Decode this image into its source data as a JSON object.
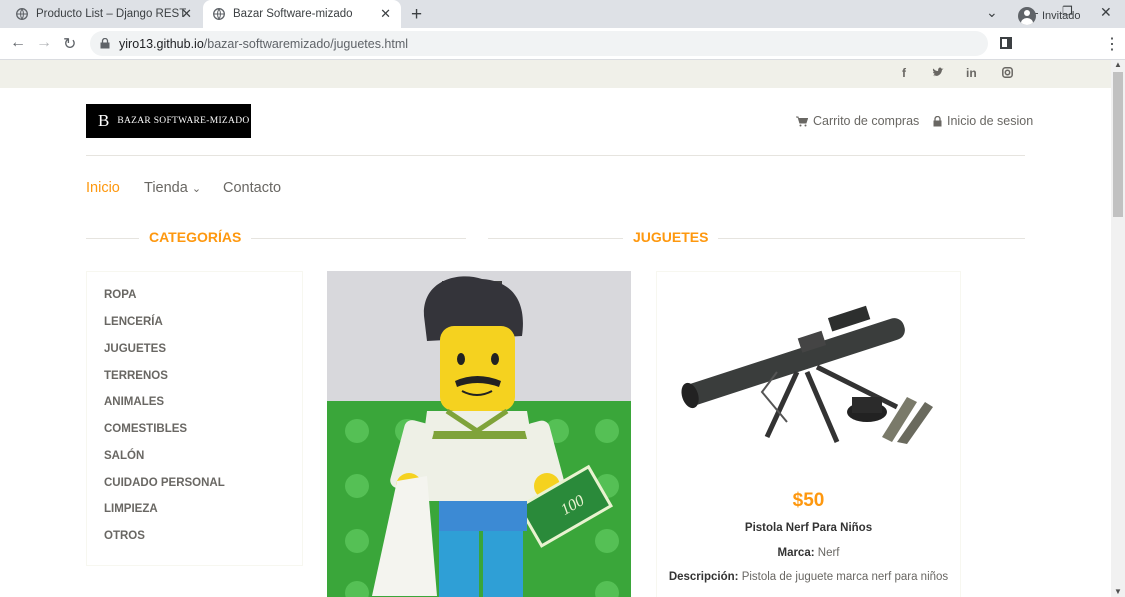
{
  "browser": {
    "tabs": [
      {
        "title": "Producto List – Django REST fram"
      },
      {
        "title": "Bazar Software-mizado"
      }
    ],
    "url_host": "yiro13.github.io",
    "url_path": "/bazar-softwaremizado/juguetes.html",
    "profile": "Invitado"
  },
  "social": [
    "f",
    "t",
    "in",
    "ig"
  ],
  "header": {
    "logo_letter": "B",
    "logo_text": "BAZAR SOFTWARE-MIZADO",
    "cart": "Carrito de compras",
    "login": "Inicio de sesion"
  },
  "nav": {
    "home": "Inicio",
    "shop": "Tienda",
    "contact": "Contacto"
  },
  "sections": {
    "categories": "CATEGORÍAS",
    "products": "JUGUETES"
  },
  "categories": [
    "ROPA",
    "LENCERÍA",
    "JUGUETES",
    "TERRENOS",
    "ANIMALES",
    "COMESTIBLES",
    "SALÓN",
    "CUIDADO PERSONAL",
    "LIMPIEZA",
    "OTROS"
  ],
  "product2": {
    "price": "$50",
    "name": "Pistola Nerf Para Niños",
    "brand_label": "Marca:",
    "brand": "Nerf",
    "desc_label": "Descripción:",
    "desc": "Pistola de juguete marca nerf para niños"
  },
  "colors": {
    "accent": "#fe980f",
    "text": "#696763",
    "strip": "#f0f0e9"
  }
}
